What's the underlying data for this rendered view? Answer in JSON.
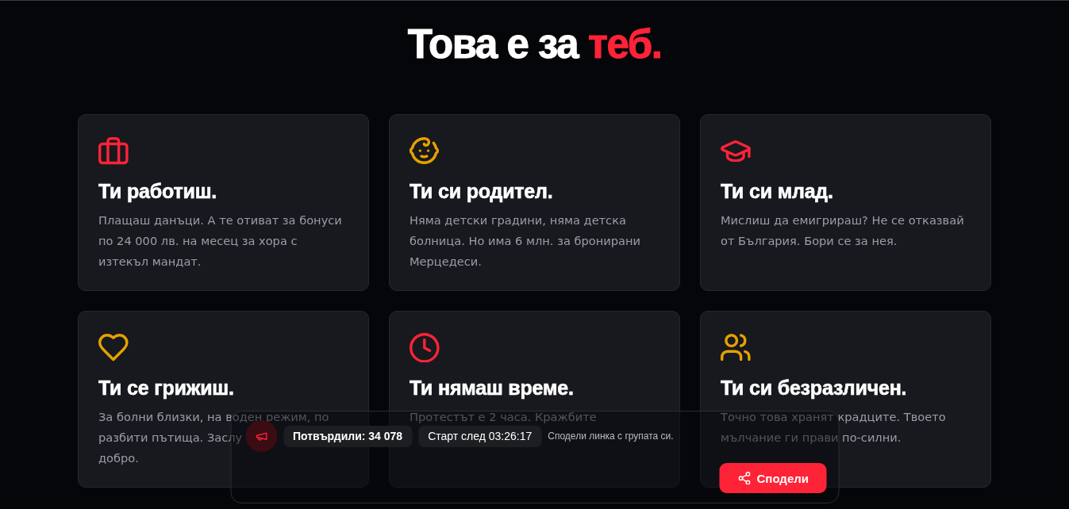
{
  "headline": {
    "text": "Това е за",
    "accent": "теб."
  },
  "cards": [
    {
      "kind": "briefcase",
      "color": "#ff2338",
      "title": "Ти работиш.",
      "text": "Плащаш данъци. А те отиват за бонуси по 24 000 лв. на месец за хора с изтекъл мандат."
    },
    {
      "kind": "baby",
      "color": "#e6a100",
      "title": "Ти си родител.",
      "text": "Няма детски градини, няма детска болница. Но има 6 млн. за бронирани Мерцедеси."
    },
    {
      "kind": "cap",
      "color": "#ff2338",
      "title": "Ти си млад.",
      "text": "Мислиш да емигрираш? Не се отказвай от България. Бори се за нея."
    },
    {
      "kind": "heart",
      "color": "#e6a100",
      "title": "Ти се грижиш.",
      "text": [
        "За болни близки, на воден режим, по",
        "разбити пътища. Заслу",
        "добро."
      ]
    },
    {
      "kind": "clock",
      "color": "#ff2338",
      "title": "Ти нямаш време.",
      "text": "Протестът е 2 часа. Кражбите"
    },
    {
      "kind": "users",
      "color": "#e6a100",
      "title": "Ти си безразличен.",
      "text": "Точно това хранят крадците. Твоето мълчание ги прави по-силни."
    }
  ],
  "share_panel": {
    "counter": "Потвърдили: 34 078",
    "countdown": "Старт след 03:26:17",
    "hint": "Сподели линка с групата си.",
    "button": "Сподели"
  }
}
